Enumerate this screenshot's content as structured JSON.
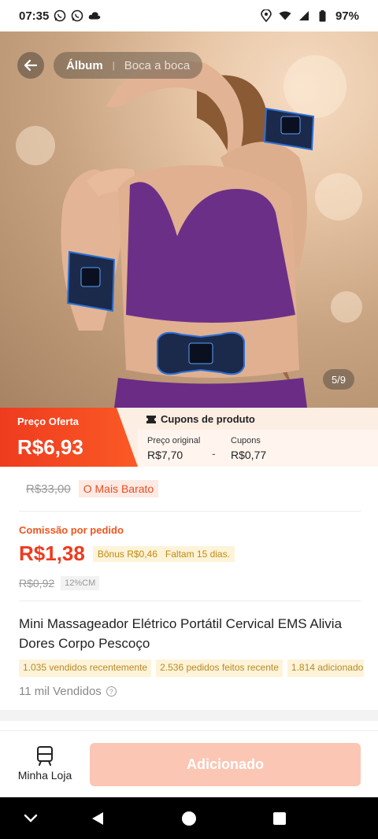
{
  "status_bar": {
    "time": "07:35",
    "battery": "97%",
    "left_icons": [
      "whatsapp-icon",
      "whatsapp-icon",
      "cloud-icon"
    ],
    "right_icons": [
      "location-icon",
      "wifi-icon",
      "signal-icon",
      "battery-icon"
    ]
  },
  "hero": {
    "tabs": [
      {
        "label": "Álbum",
        "active": true
      },
      {
        "label": "Boca a boca",
        "active": false
      }
    ],
    "image_counter": "5/9"
  },
  "price_banner": {
    "offer_label": "Preço Oferta",
    "offer_price": "R$6,93",
    "coupon_title": "Cupons de produto",
    "original_label": "Preço original",
    "original_value": "R$7,70",
    "minus_sign": "-",
    "coupons_label": "Cupons",
    "coupons_value": "R$0,77"
  },
  "pricing": {
    "old_price": "R$33,00",
    "cheapest_badge": "O Mais Barato"
  },
  "commission": {
    "label": "Comissão por pedido",
    "value": "R$1,38",
    "bonus": "Bônus R$0,46",
    "remaining": "Faltam 15 dias.",
    "old_value": "R$0,92",
    "rate": "12%CM"
  },
  "product": {
    "title": "Mini Massageador Elétrico Portátil Cervical EMS Alivia Dores Corpo Pescoço",
    "chips": [
      "1.035 vendidos recentemente",
      "2.536 pedidos feitos recente",
      "1.814 adicionado"
    ],
    "sold": "11 mil Vendidos"
  },
  "bottom_bar": {
    "store_label": "Minha Loja",
    "added_label": "Adicionado"
  },
  "colors": {
    "accent": "#ee3b1f",
    "offer_gradient_end": "#fb5a25",
    "banner_bg": "#fdeee4",
    "added_button": "#fbc6b3",
    "bonus_text": "#c08a10"
  }
}
